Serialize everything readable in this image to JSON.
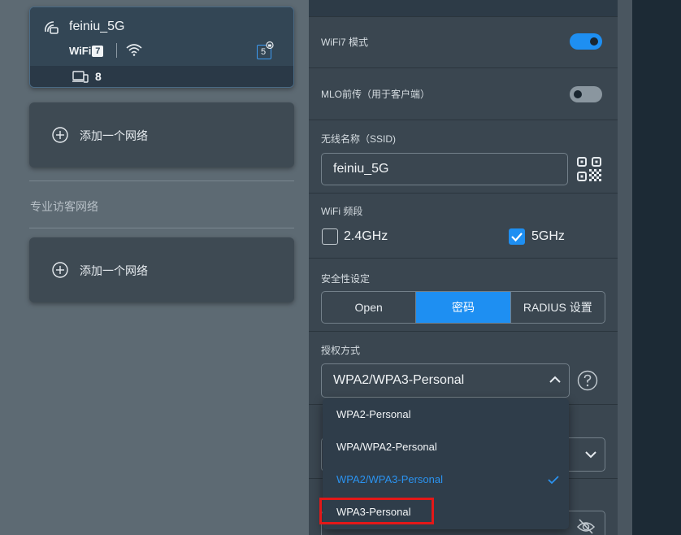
{
  "network_card": {
    "ssid": "feiniu_5G",
    "wifi_badge": "WiFi",
    "wifi_gen": "7",
    "band_tag": "5",
    "client_count": "8"
  },
  "add_network_1": "添加一个网络",
  "guest_section_label": "专业访客网络",
  "add_network_2": "添加一个网络",
  "settings": {
    "wifi7_mode_label": "WiFi7 模式",
    "wifi7_mode_on": true,
    "mlo_label": "MLO前传（用于客户端）",
    "mlo_on": false,
    "ssid_label": "无线名称（SSID)",
    "ssid_value": "feiniu_5G",
    "band_label": "WiFi 频段",
    "band_24": "2.4GHz",
    "band_24_checked": false,
    "band_5": "5GHz",
    "band_5_checked": true,
    "security_label": "安全性设定",
    "security_tabs": [
      "Open",
      "密码",
      "RADIUS 设置"
    ],
    "security_active": "密码",
    "auth_label": "授权方式",
    "auth_value": "WPA2/WPA3-Personal"
  },
  "auth_options": [
    "WPA2-Personal",
    "WPA/WPA2-Personal",
    "WPA2/WPA3-Personal",
    "WPA3-Personal"
  ],
  "auth_selected": "WPA2/WPA3-Personal",
  "colors": {
    "accent": "#1e8ff2",
    "highlight": "#e31818",
    "panel": "#3a4650"
  },
  "icons": [
    "network-settings-icon",
    "wifi-icon",
    "lock-icon",
    "devices-icon",
    "plus-circle-icon",
    "qr-code-icon",
    "help-icon",
    "chevron-up-icon",
    "check-icon",
    "eye-off-icon"
  ]
}
